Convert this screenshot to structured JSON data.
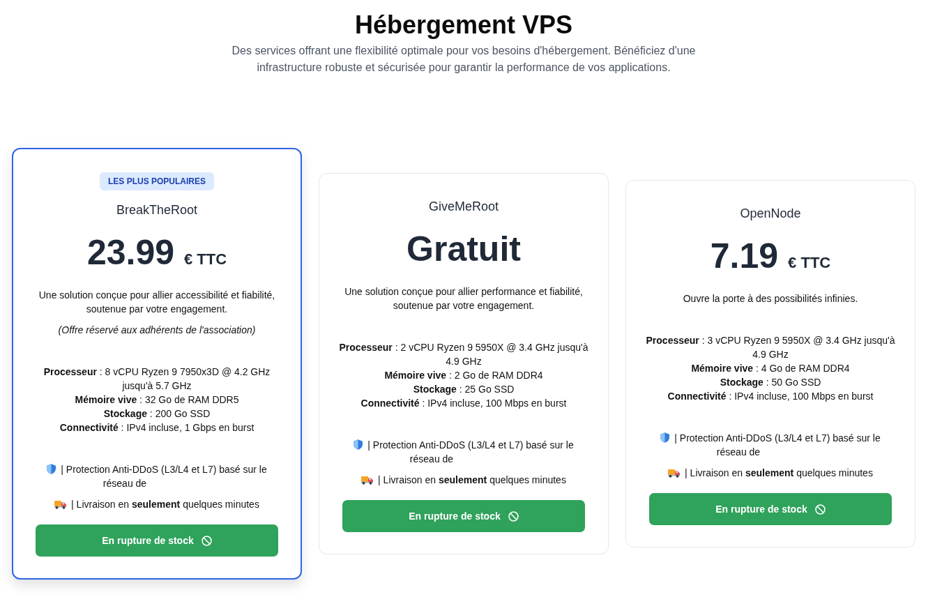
{
  "header": {
    "title": "Hébergement VPS",
    "subtitle": "Des services offrant une flexibilité optimale pour vos besoins d'hébergement. Bénéficiez d'une infrastructure robuste et sécurisée pour garantir la performance de vos applications."
  },
  "plans": [
    {
      "highlighted": true,
      "badge": "LES PLUS POPULAIRES",
      "name": "BreakTheRoot",
      "price": "23.99",
      "unit": "€ TTC",
      "description": "Une solution conçue pour allier accessibilité et fiabilité, soutenue par votre engagement.",
      "note": "(Offre réservé aux adhérents de l'association)",
      "specs": [
        "**Processeur** : 8 vCPU Ryzen 9 7950x3D @ 4.2 GHz jusqu'à 5.7 GHz",
        "**Mémoire vive** : 32 Go de RAM DDR5",
        "**Stockage** : 200 Go SSD",
        "**Connectivité** : IPv4 incluse, 1 Gbps en burst"
      ],
      "features": [
        {
          "kind": "shield",
          "text": "| Protection Anti-DDoS (L3/L4 et L7) basé sur le réseau de"
        },
        {
          "kind": "truck",
          "text": "| Livraison en **seulement** quelques minutes"
        }
      ],
      "button": "En rupture de stock"
    },
    {
      "highlighted": false,
      "name": "GiveMeRoot",
      "price": "Gratuit",
      "description": "Une solution conçue pour allier performance et fiabilité, soutenue par votre engagement.",
      "specs": [
        "**Processeur** : 2 vCPU Ryzen 9 5950X @ 3.4 GHz jusqu'à 4.9 GHz",
        "**Mémoire vive** : 2 Go de RAM DDR4",
        "**Stockage** : 25 Go SSD",
        "**Connectivité** : IPv4 incluse, 100 Mbps en burst"
      ],
      "features": [
        {
          "kind": "shield",
          "text": "| Protection Anti-DDoS (L3/L4 et L7) basé sur le réseau de"
        },
        {
          "kind": "truck",
          "text": "| Livraison en **seulement** quelques minutes"
        }
      ],
      "button": "En rupture de stock"
    },
    {
      "highlighted": false,
      "name": "OpenNode",
      "price": "7.19",
      "unit": "€ TTC",
      "description": "Ouvre la porte à des possibilités infinies.",
      "specs": [
        "**Processeur** : 3 vCPU Ryzen 9 5950X @ 3.4 GHz jusqu'à 4.9 GHz",
        "**Mémoire vive** : 4 Go de RAM DDR4",
        "**Stockage** : 50 Go SSD",
        "**Connectivité** : IPv4 incluse, 100 Mbps en burst"
      ],
      "features": [
        {
          "kind": "shield",
          "text": "| Protection Anti-DDoS (L3/L4 et L7) basé sur le réseau de"
        },
        {
          "kind": "truck",
          "text": "| Livraison en **seulement** quelques minutes"
        }
      ],
      "button": "En rupture de stock"
    }
  ]
}
